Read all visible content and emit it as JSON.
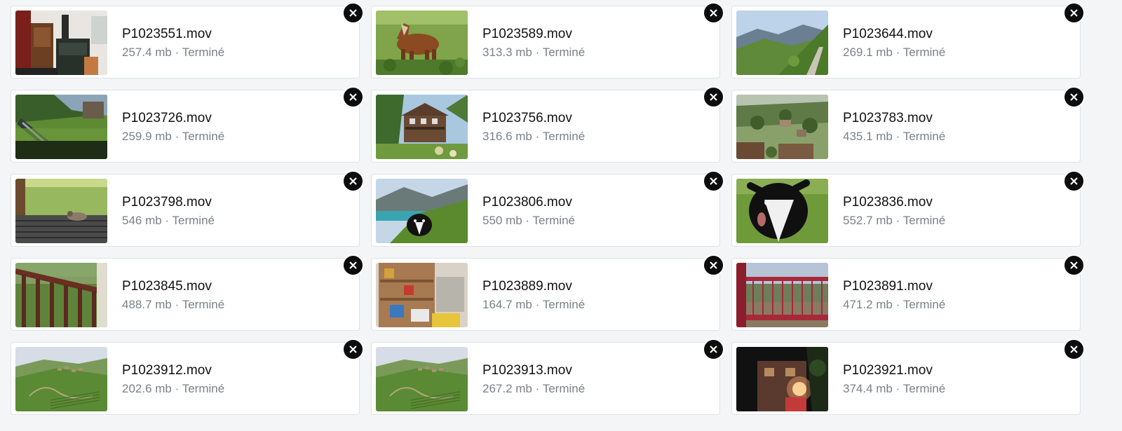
{
  "files": [
    {
      "name": "P1023551.mov",
      "size": "257.4 mb",
      "status": "Terminé",
      "thumb": "interior"
    },
    {
      "name": "P1023589.mov",
      "size": "313.3 mb",
      "status": "Terminé",
      "thumb": "horse"
    },
    {
      "name": "P1023644.mov",
      "size": "269.1 mb",
      "status": "Terminé",
      "thumb": "valley"
    },
    {
      "name": "P1023726.mov",
      "size": "259.9 mb",
      "status": "Terminé",
      "thumb": "deckchair"
    },
    {
      "name": "P1023756.mov",
      "size": "316.6 mb",
      "status": "Terminé",
      "thumb": "chalet"
    },
    {
      "name": "P1023783.mov",
      "size": "435.1 mb",
      "status": "Terminé",
      "thumb": "village"
    },
    {
      "name": "P1023798.mov",
      "size": "546 mb",
      "status": "Terminé",
      "thumb": "terrace-dog"
    },
    {
      "name": "P1023806.mov",
      "size": "550 mb",
      "status": "Terminé",
      "thumb": "lake-dog"
    },
    {
      "name": "P1023836.mov",
      "size": "552.7 mb",
      "status": "Terminé",
      "thumb": "dog-closeup"
    },
    {
      "name": "P1023845.mov",
      "size": "488.7 mb",
      "status": "Terminé",
      "thumb": "railing"
    },
    {
      "name": "P1023889.mov",
      "size": "164.7 mb",
      "status": "Terminé",
      "thumb": "shelves"
    },
    {
      "name": "P1023891.mov",
      "size": "471.2 mb",
      "status": "Terminé",
      "thumb": "red-gate"
    },
    {
      "name": "P1023912.mov",
      "size": "202.6 mb",
      "status": "Terminé",
      "thumb": "hills"
    },
    {
      "name": "P1023913.mov",
      "size": "267.2 mb",
      "status": "Terminé",
      "thumb": "hills"
    },
    {
      "name": "P1023921.mov",
      "size": "374.4 mb",
      "status": "Terminé",
      "thumb": "night-house"
    }
  ],
  "separator": " · ",
  "close_icon": "close-icon"
}
